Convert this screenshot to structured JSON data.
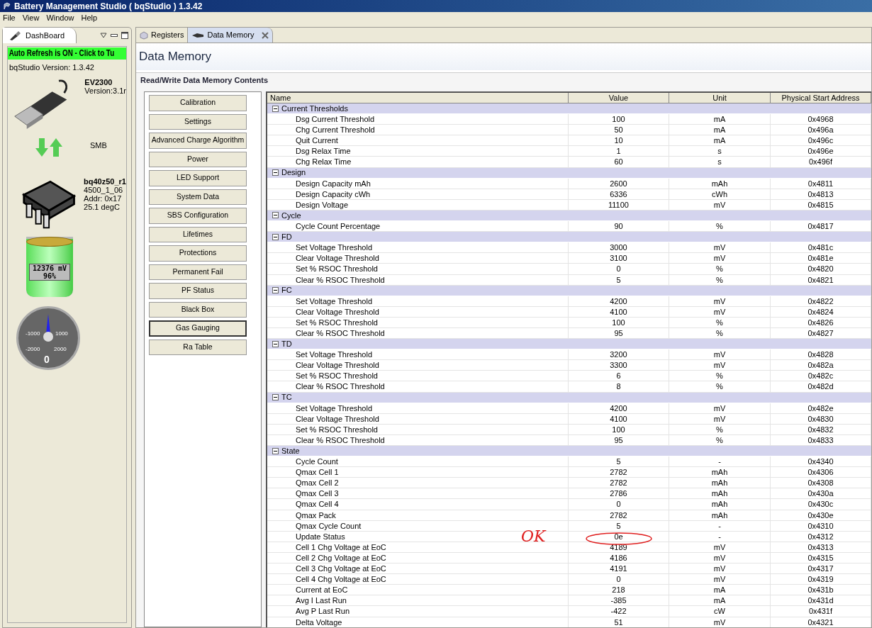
{
  "window": {
    "title": "Battery Management Studio ( bqStudio ) 1.3.42"
  },
  "menu": [
    "File",
    "View",
    "Window",
    "Help"
  ],
  "dashboard": {
    "tab": "DashBoard",
    "auto_refresh": "Auto Refresh is ON - Click to Tu",
    "version": "bqStudio Version:  1.3.42",
    "adapter": {
      "name": "EV2300",
      "lines": [
        "Version:3.1r"
      ]
    },
    "bus": {
      "name": "SMB"
    },
    "device": {
      "name": "bq40z50_r1",
      "lines": [
        "4500_1_06",
        "Addr: 0x17",
        "25.1 degC"
      ]
    },
    "battery": {
      "voltage": "12376 mV",
      "percent": "96%",
      "level": 0.96
    },
    "gauge": {
      "labels": [
        "-1000",
        "1000",
        "-2000",
        "2000"
      ],
      "reading": "0"
    }
  },
  "tabs": [
    {
      "label": "Registers",
      "selected": false
    },
    {
      "label": "Data Memory",
      "selected": true
    }
  ],
  "page": {
    "title": "Data Memory",
    "section": "Read/Write Data Memory Contents"
  },
  "classes": [
    {
      "label": "Calibration",
      "selected": false
    },
    {
      "label": "Settings",
      "selected": false
    },
    {
      "label": "Advanced Charge Algorithm",
      "selected": false
    },
    {
      "label": "Power",
      "selected": false
    },
    {
      "label": "LED Support",
      "selected": false
    },
    {
      "label": "System Data",
      "selected": false
    },
    {
      "label": "SBS Configuration",
      "selected": false
    },
    {
      "label": "Lifetimes",
      "selected": false
    },
    {
      "label": "Protections",
      "selected": false
    },
    {
      "label": "Permanent Fail",
      "selected": false
    },
    {
      "label": "PF Status",
      "selected": false
    },
    {
      "label": "Black Box",
      "selected": false
    },
    {
      "label": "Gas Gauging",
      "selected": true
    },
    {
      "label": "Ra Table",
      "selected": false
    }
  ],
  "table": {
    "columns": [
      "Name",
      "Value",
      "Unit",
      "Physical Start Address"
    ],
    "groups": [
      {
        "name": "Current Thresholds",
        "expanded": true,
        "children": [
          [
            "Dsg Current Threshold",
            "100",
            "mA",
            "0x4968"
          ],
          [
            "Chg Current Threshold",
            "50",
            "mA",
            "0x496a"
          ],
          [
            "Quit Current",
            "10",
            "mA",
            "0x496c"
          ],
          [
            "Dsg Relax Time",
            "1",
            "s",
            "0x496e"
          ],
          [
            "Chg Relax Time",
            "60",
            "s",
            "0x496f"
          ]
        ]
      },
      {
        "name": "Design",
        "expanded": true,
        "children": [
          [
            "Design Capacity mAh",
            "2600",
            "mAh",
            "0x4811"
          ],
          [
            "Design Capacity cWh",
            "6336",
            "cWh",
            "0x4813"
          ],
          [
            "Design Voltage",
            "11100",
            "mV",
            "0x4815"
          ]
        ]
      },
      {
        "name": "Cycle",
        "expanded": true,
        "children": [
          [
            "Cycle Count Percentage",
            "90",
            "%",
            "0x4817"
          ]
        ]
      },
      {
        "name": "FD",
        "expanded": true,
        "children": [
          [
            "Set Voltage Threshold",
            "3000",
            "mV",
            "0x481c"
          ],
          [
            "Clear Voltage Threshold",
            "3100",
            "mV",
            "0x481e"
          ],
          [
            "Set % RSOC Threshold",
            "0",
            "%",
            "0x4820"
          ],
          [
            "Clear % RSOC Threshold",
            "5",
            "%",
            "0x4821"
          ]
        ]
      },
      {
        "name": "FC",
        "expanded": true,
        "children": [
          [
            "Set Voltage Threshold",
            "4200",
            "mV",
            "0x4822"
          ],
          [
            "Clear Voltage Threshold",
            "4100",
            "mV",
            "0x4824"
          ],
          [
            "Set % RSOC Threshold",
            "100",
            "%",
            "0x4826"
          ],
          [
            "Clear % RSOC Threshold",
            "95",
            "%",
            "0x4827"
          ]
        ]
      },
      {
        "name": "TD",
        "expanded": true,
        "children": [
          [
            "Set Voltage Threshold",
            "3200",
            "mV",
            "0x4828"
          ],
          [
            "Clear Voltage Threshold",
            "3300",
            "mV",
            "0x482a"
          ],
          [
            "Set % RSOC Threshold",
            "6",
            "%",
            "0x482c"
          ],
          [
            "Clear % RSOC Threshold",
            "8",
            "%",
            "0x482d"
          ]
        ]
      },
      {
        "name": "TC",
        "expanded": true,
        "children": [
          [
            "Set Voltage Threshold",
            "4200",
            "mV",
            "0x482e"
          ],
          [
            "Clear Voltage Threshold",
            "4100",
            "mV",
            "0x4830"
          ],
          [
            "Set % RSOC Threshold",
            "100",
            "%",
            "0x4832"
          ],
          [
            "Clear % RSOC Threshold",
            "95",
            "%",
            "0x4833"
          ]
        ]
      },
      {
        "name": "State",
        "expanded": true,
        "children": [
          [
            "Cycle Count",
            "5",
            "-",
            "0x4340"
          ],
          [
            "Qmax Cell 1",
            "2782",
            "mAh",
            "0x4306"
          ],
          [
            "Qmax Cell 2",
            "2782",
            "mAh",
            "0x4308"
          ],
          [
            "Qmax Cell 3",
            "2786",
            "mAh",
            "0x430a"
          ],
          [
            "Qmax Cell 4",
            "0",
            "mAh",
            "0x430c"
          ],
          [
            "Qmax Pack",
            "2782",
            "mAh",
            "0x430e"
          ],
          [
            "Qmax Cycle Count",
            "5",
            "-",
            "0x4310"
          ],
          [
            "Update Status",
            "0e",
            "-",
            "0x4312"
          ],
          [
            "Cell 1 Chg Voltage at EoC",
            "4189",
            "mV",
            "0x4313"
          ],
          [
            "Cell 2 Chg Voltage at EoC",
            "4186",
            "mV",
            "0x4315"
          ],
          [
            "Cell 3 Chg Voltage at EoC",
            "4191",
            "mV",
            "0x4317"
          ],
          [
            "Cell 4 Chg Voltage at EoC",
            "0",
            "mV",
            "0x4319"
          ],
          [
            "Current at EoC",
            "218",
            "mA",
            "0x431b"
          ],
          [
            "Avg I Last Run",
            "-385",
            "mA",
            "0x431d"
          ],
          [
            "Avg P Last Run",
            "-422",
            "cW",
            "0x431f"
          ],
          [
            "Delta Voltage",
            "51",
            "mV",
            "0x4321"
          ]
        ]
      }
    ]
  },
  "annotation": {
    "text": "OK"
  }
}
